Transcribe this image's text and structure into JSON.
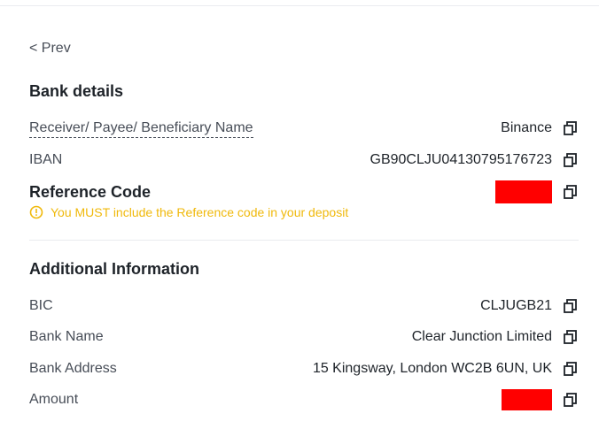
{
  "nav": {
    "prev_label": "< Prev"
  },
  "bank_details": {
    "title": "Bank details",
    "receiver": {
      "label": "Receiver/ Payee/ Beneficiary Name",
      "value": "Binance"
    },
    "iban": {
      "label": "IBAN",
      "value": "GB90CLJU04130795176723"
    },
    "reference": {
      "label": "Reference Code",
      "value": ""
    },
    "warning": "You MUST include the Reference code in your deposit"
  },
  "additional": {
    "title": "Additional Information",
    "bic": {
      "label": "BIC",
      "value": "CLJUGB21"
    },
    "bank_name": {
      "label": "Bank Name",
      "value": "Clear Junction Limited"
    },
    "bank_address": {
      "label": "Bank Address",
      "value": "15 Kingsway, London WC2B 6UN, UK"
    },
    "amount": {
      "label": "Amount",
      "value": ""
    }
  },
  "colors": {
    "warning": "#f0b90b",
    "text_primary": "#1e2329",
    "text_secondary": "#474d57",
    "redaction": "#ff0000"
  },
  "icons": {
    "copy": "copy-icon",
    "warning": "warning-circle-icon"
  }
}
